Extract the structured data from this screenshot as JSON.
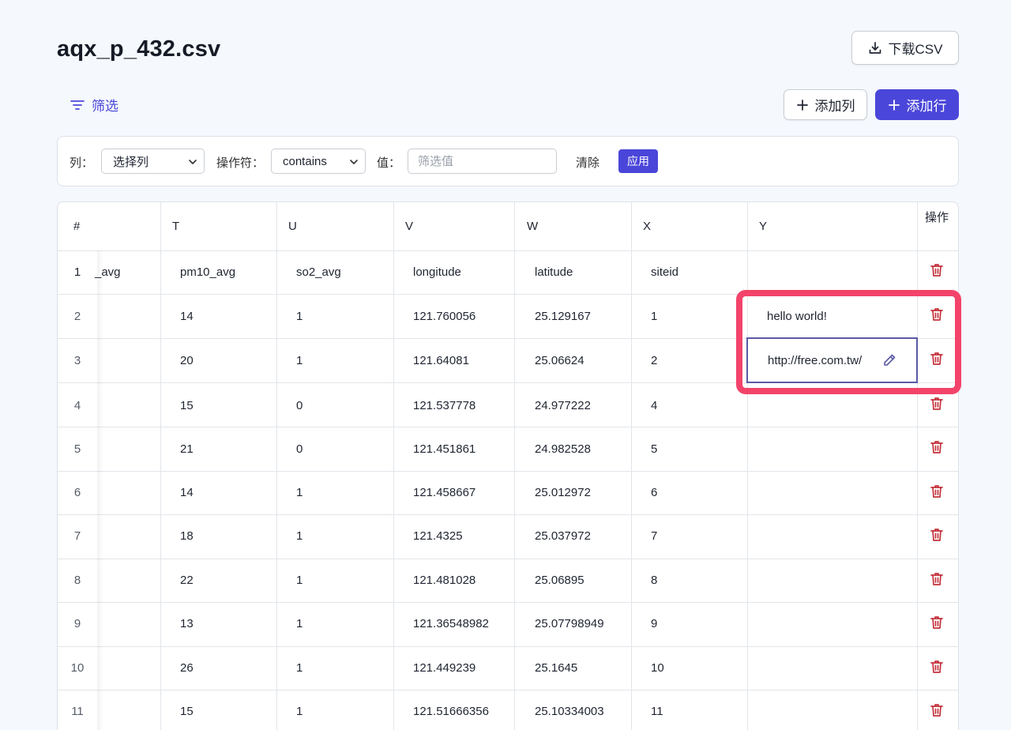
{
  "file_title": "aqx_p_432.csv",
  "toolbar": {
    "download_label": "下载CSV",
    "add_column_label": "添加列",
    "add_row_label": "添加行",
    "filter_toggle_label": "筛选"
  },
  "filter": {
    "column_label": "列：",
    "column_value": "选择列",
    "operator_label": "操作符：",
    "operator_value": "contains",
    "value_label": "值：",
    "value_placeholder": "筛选值",
    "clear_label": "清除",
    "apply_label": "应用"
  },
  "table": {
    "index_header": "#",
    "column_letters": [
      "T",
      "U",
      "V",
      "W",
      "X",
      "Y"
    ],
    "actions_header": "操作",
    "rows": [
      [
        "1",
        "_avg",
        "pm10_avg",
        "so2_avg",
        "longitude",
        "latitude",
        "siteid",
        ""
      ],
      [
        "2",
        "",
        "14",
        "1",
        "121.760056",
        "25.129167",
        "1",
        "hello world!"
      ],
      [
        "3",
        "",
        "20",
        "1",
        "121.64081",
        "25.06624",
        "2",
        "http://free.com.tw/"
      ],
      [
        "4",
        "",
        "15",
        "0",
        "121.537778",
        "24.977222",
        "4",
        ""
      ],
      [
        "5",
        "",
        "21",
        "0",
        "121.451861",
        "24.982528",
        "5",
        ""
      ],
      [
        "6",
        "",
        "14",
        "1",
        "121.458667",
        "25.012972",
        "6",
        ""
      ],
      [
        "7",
        "",
        "18",
        "1",
        "121.4325",
        "25.037972",
        "7",
        ""
      ],
      [
        "8",
        "",
        "22",
        "1",
        "121.481028",
        "25.06895",
        "8",
        ""
      ],
      [
        "9",
        "",
        "13",
        "1",
        "121.36548982",
        "25.07798949",
        "9",
        ""
      ],
      [
        "10",
        "",
        "26",
        "1",
        "121.449239",
        "25.1645",
        "10",
        ""
      ],
      [
        "11",
        "",
        "15",
        "1",
        "121.51666356",
        "25.10334003",
        "11",
        ""
      ]
    ]
  },
  "icons": {
    "download": "download-icon",
    "filter": "filter-lines-icon",
    "plus": "plus-icon",
    "chevron": "chevron-down-icon",
    "trash": "trash-icon",
    "pencil": "pencil-icon"
  },
  "colors": {
    "accent": "#4a46d9",
    "trash": "#c4323b",
    "highlight": "#f3436a",
    "edit_border": "#5b5aa6"
  }
}
